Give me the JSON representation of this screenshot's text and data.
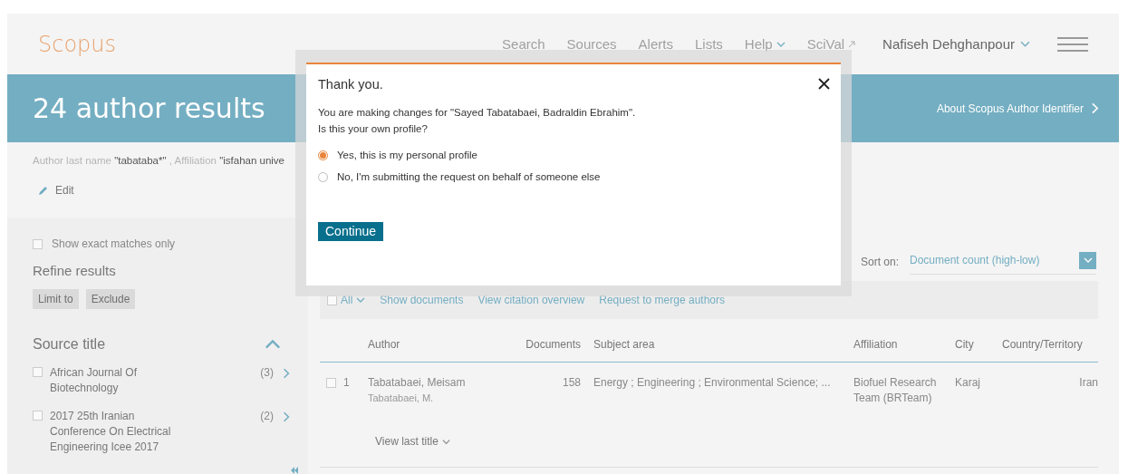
{
  "header": {
    "logo": "Scopus",
    "nav": [
      {
        "label": "Search",
        "kind": "plain"
      },
      {
        "label": "Sources",
        "kind": "plain"
      },
      {
        "label": "Alerts",
        "kind": "plain"
      },
      {
        "label": "Lists",
        "kind": "plain"
      },
      {
        "label": "Help",
        "kind": "dropdown"
      },
      {
        "label": "SciVal",
        "kind": "external"
      }
    ],
    "user_name": "Nafiseh Dehghanpour"
  },
  "banner": {
    "title": "24 author results",
    "about_link": "About Scopus Author Identifier"
  },
  "query": {
    "text": "Author last name **\"tabataba*\"** , Affiliation **\"isfahan unive**",
    "edit": "Edit"
  },
  "sidebar": {
    "exact_matches": {
      "label": "Show exact matches only",
      "checked": false
    },
    "refine_title": "Refine results",
    "buttons": [
      {
        "label": "Limit to",
        "disabled": true
      },
      {
        "label": "Exclude",
        "disabled": true
      }
    ],
    "source_title": {
      "heading": "Source title",
      "expanded": true
    },
    "items": [
      {
        "label": "African Journal Of Biotechnology",
        "count": "(3)",
        "checked": false
      },
      {
        "label": "2017 25th Iranian Conference On Electrical Engineering Icee 2017",
        "count": "(2)",
        "checked": false
      }
    ]
  },
  "results": {
    "sort_label": "Sort on:",
    "sort_value": "Document count (high-low)",
    "toolbar": {
      "all_label": "All",
      "all_checked": false,
      "links": [
        "Show documents",
        "View citation overview",
        "Request to merge authors"
      ]
    },
    "columns": [
      "Author",
      "Documents",
      "Subject area",
      "Affiliation",
      "City",
      "Country/Territory"
    ],
    "rows": [
      {
        "number": "1",
        "checked": false,
        "author": "Tabatabaei, Meisam",
        "author_variant": "Tabatabaei, M.",
        "documents": "158",
        "subject_area": "Energy ; Engineering ; Environmental Science; ...",
        "affiliation": "Biofuel Research Team (BRTeam)",
        "city": "Karaj",
        "country": "Iran",
        "view_last_title": "View last title"
      }
    ]
  },
  "dialog": {
    "title": "Thank you.",
    "message": [
      "You are making changes for \"Sayed Tabatabaei, Badraldin Ebrahim\".",
      "Is this your own profile?"
    ],
    "options": [
      {
        "label": "Yes, this is my personal profile",
        "selected": true
      },
      {
        "label": "No, I'm submitting the request on behalf of someone else",
        "selected": false
      }
    ],
    "button": "Continue"
  }
}
